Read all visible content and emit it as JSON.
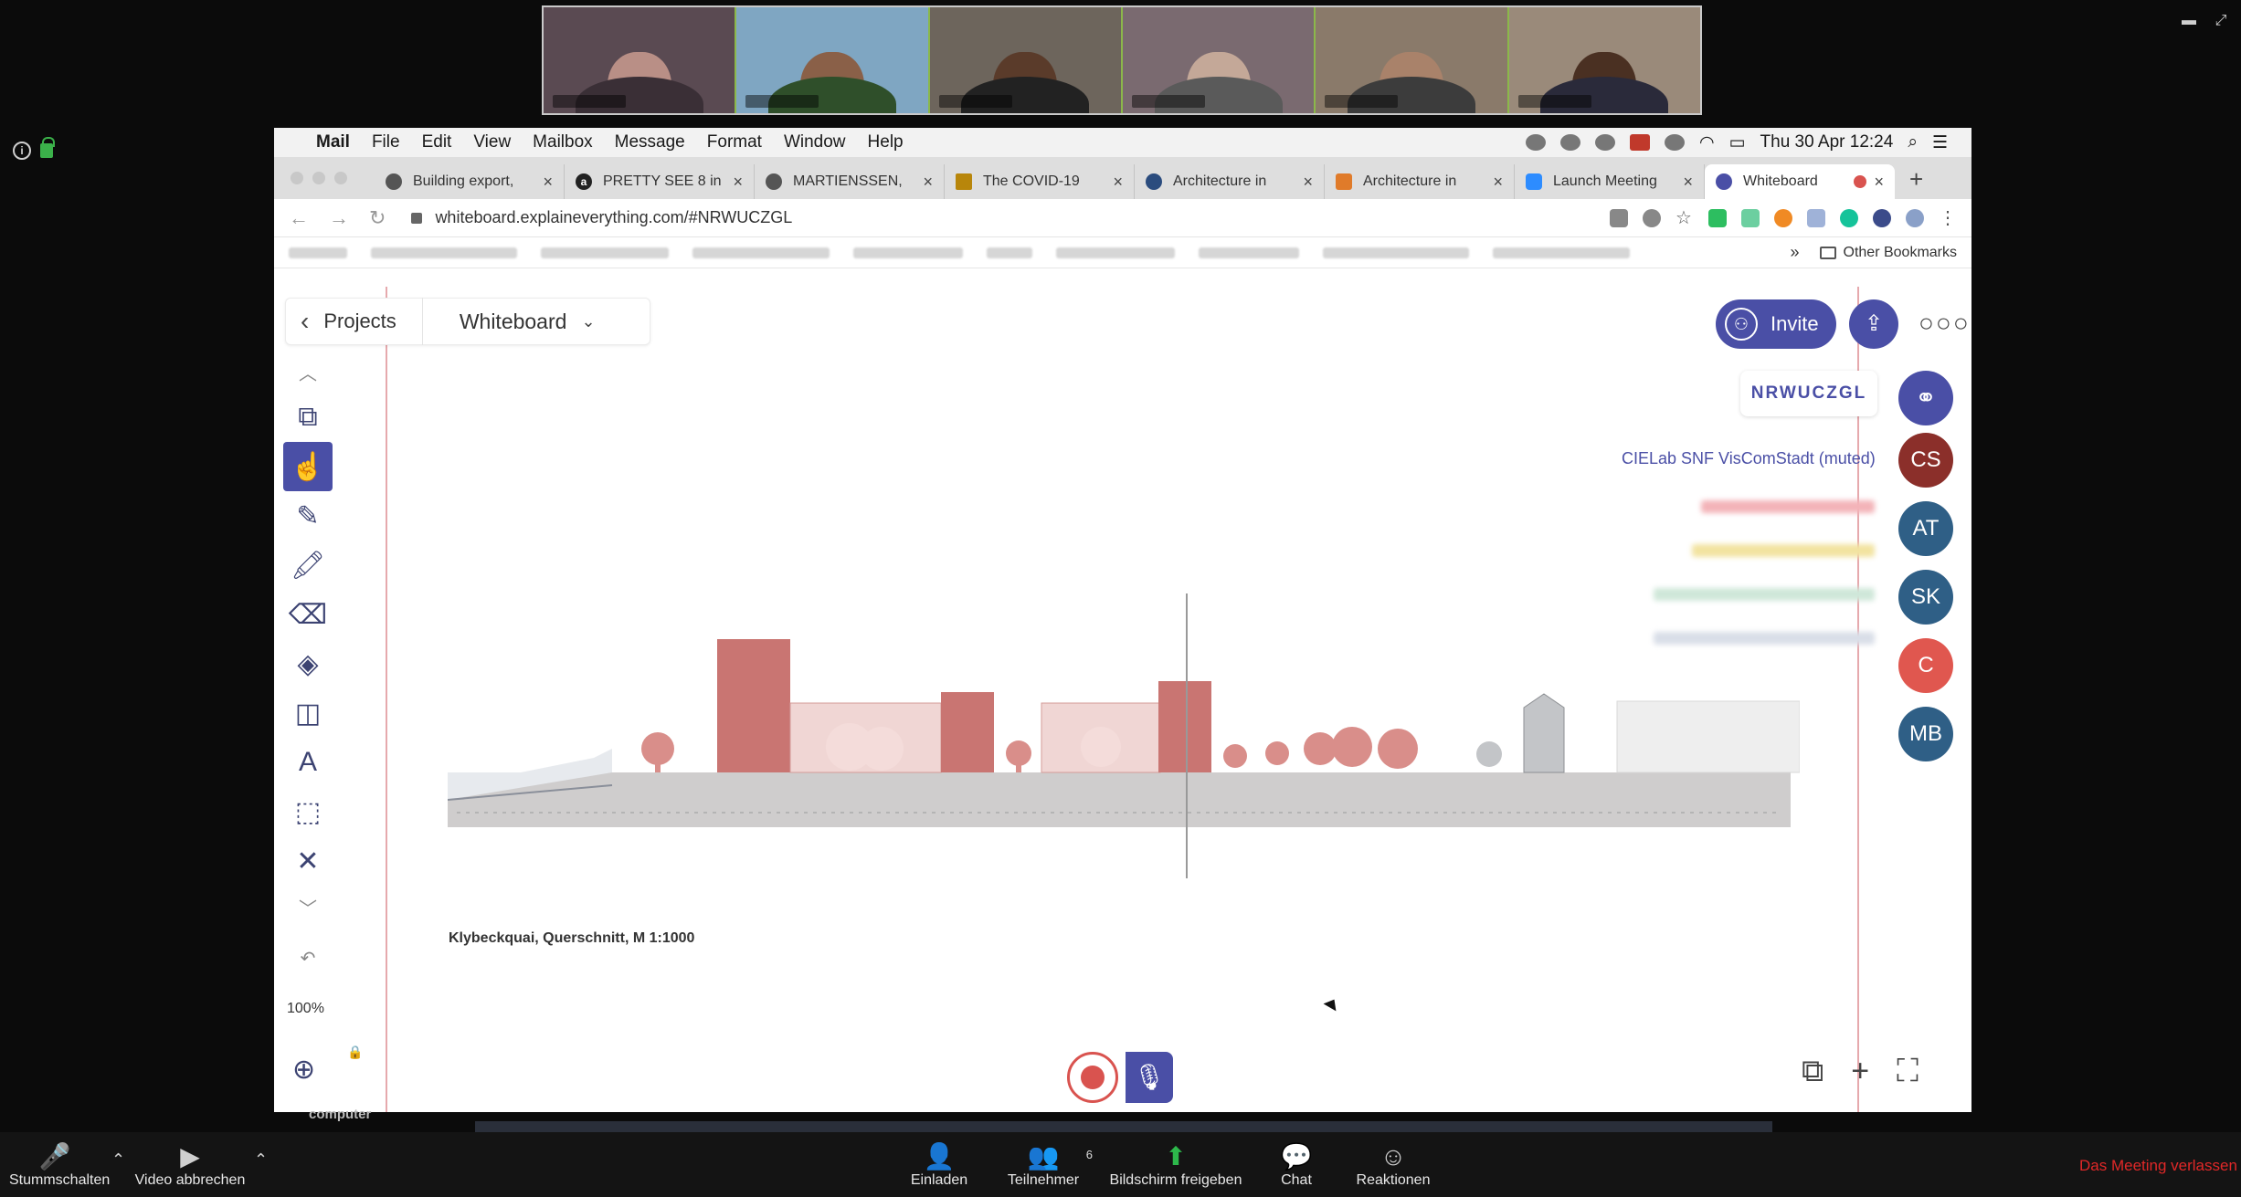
{
  "menubar": {
    "app": "Mail",
    "items": [
      "File",
      "Edit",
      "View",
      "Mailbox",
      "Message",
      "Format",
      "Window",
      "Help"
    ],
    "clock": "Thu 30 Apr  12:24"
  },
  "tabs": [
    {
      "title": "Building export,"
    },
    {
      "title": "PRETTY SEE 8 in"
    },
    {
      "title": "MARTIENSSEN, "
    },
    {
      "title": "The COVID-19 "
    },
    {
      "title": "Architecture in "
    },
    {
      "title": "Architecture in "
    },
    {
      "title": "Launch Meeting"
    },
    {
      "title": "Whiteboard"
    }
  ],
  "address": {
    "url": "whiteboard.explaineverything.com/#NRWUCZGL"
  },
  "bookmarks": {
    "other": "Other Bookmarks",
    "more": "»"
  },
  "app": {
    "back_label": "Projects",
    "board_name": "Whiteboard",
    "invite_label": "Invite",
    "session_code": "NRWUCZGL",
    "muted_participant": "CIELab SNF VisComStadt (muted)",
    "zoom_level": "100%",
    "avatars": [
      {
        "initials": "CS",
        "color": "#8b2f2a"
      },
      {
        "initials": "AT",
        "color": "#2f5f86"
      },
      {
        "initials": "SK",
        "color": "#2f5f86"
      },
      {
        "initials": "C",
        "color": "#e0574f"
      },
      {
        "initials": "MB",
        "color": "#2f5f86"
      }
    ],
    "drawing_caption": "Klybeckquai, Querschnitt, M 1:1000"
  },
  "zoom": {
    "screen_label": "computer",
    "mute_label": "Stummschalten",
    "video_label": "Video abbrechen",
    "invite_label": "Einladen",
    "participants_label": "Teilnehmer",
    "participants_count": "6",
    "share_label": "Bildschirm freigeben",
    "chat_label": "Chat",
    "reactions_label": "Reaktionen",
    "leave_label": "Das Meeting verlassen"
  }
}
